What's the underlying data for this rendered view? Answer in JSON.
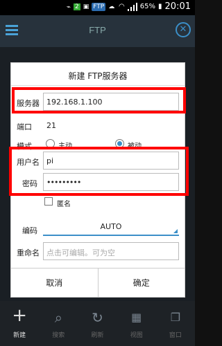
{
  "status_bar": {
    "app_chip": "FTP",
    "battery": "65%",
    "time": "20:01"
  },
  "app_bar": {
    "title": "FTP"
  },
  "dialog": {
    "title": "新建 FTP服务器",
    "server_label": "服务器",
    "server_value": "192.168.1.100",
    "port_label": "端口",
    "port_value": "21",
    "mode_label": "模式",
    "mode_options": [
      "主动",
      "被动"
    ],
    "mode_selected": "被动",
    "username_label": "用户名",
    "username_value": "pi",
    "password_label": "密码",
    "password_value": "•••••••••",
    "anonymous_label": "匿名",
    "encoding_label": "编码",
    "encoding_value": "AUTO",
    "rename_label": "重命名",
    "rename_placeholder": "点击可编辑。可为空",
    "cancel_label": "取消",
    "confirm_label": "确定"
  },
  "toolbar": {
    "items": [
      {
        "label": "新建",
        "icon": "plus-icon"
      },
      {
        "label": "搜索",
        "icon": "search-icon"
      },
      {
        "label": "刷新",
        "icon": "refresh-icon"
      },
      {
        "label": "视图",
        "icon": "grid-icon"
      },
      {
        "label": "窗口",
        "icon": "windows-icon"
      }
    ]
  },
  "colors": {
    "highlight": "#ff0000",
    "accent": "#3b8fc8"
  }
}
